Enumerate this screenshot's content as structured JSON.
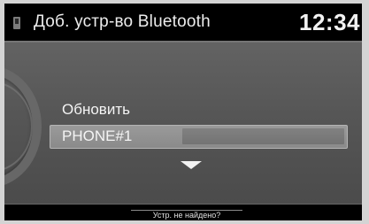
{
  "header": {
    "title": "Доб. устр-во Bluetooth",
    "clock": "12:34",
    "icon": "phone-icon"
  },
  "menu": {
    "items": [
      {
        "label": "Обновить",
        "selected": false
      },
      {
        "label": "PHONE#1",
        "selected": true
      }
    ]
  },
  "footer": {
    "down_arrow_icon": "chevron-down-icon",
    "not_found_label": "Устр. не найдено?"
  },
  "colors": {
    "screen_bg": "#000000",
    "panel_bg": "#5a5a5a",
    "highlight": "#8f8f8f",
    "text": "#f4f4f4"
  }
}
